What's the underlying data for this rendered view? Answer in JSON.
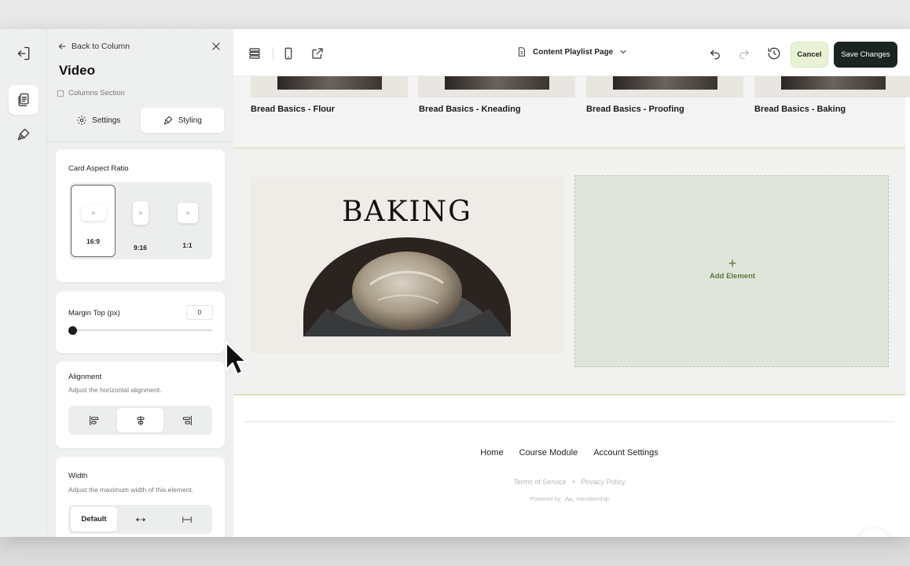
{
  "panel": {
    "back_label": "Back to Column",
    "title": "Video",
    "breadcrumb": "Columns Section",
    "tabs": [
      {
        "label": "Settings",
        "icon": "gear-icon"
      },
      {
        "label": "Styling",
        "icon": "brush-icon",
        "active": true
      }
    ],
    "aspect_ratio": {
      "label": "Card Aspect Ratio",
      "options": [
        {
          "label": "16:9",
          "active": true
        },
        {
          "label": "9:16"
        },
        {
          "label": "1:1"
        }
      ]
    },
    "margin_top": {
      "label": "Margin Top (px)",
      "value": "0"
    },
    "alignment": {
      "label": "Alignment",
      "description": "Adjust the horizontal alignment.",
      "selected": "center"
    },
    "width": {
      "label": "Width",
      "description": "Adjust the maximum width of this element.",
      "options": [
        "Default"
      ]
    }
  },
  "toolbar": {
    "page_name": "Content Playlist Page",
    "cancel_label": "Cancel",
    "save_label": "Save Changes"
  },
  "canvas": {
    "videos": [
      {
        "title": "Bread Basics - Flour"
      },
      {
        "title": "Bread Basics - Kneading"
      },
      {
        "title": "Bread Basics - Proofing"
      },
      {
        "title": "Bread Basics - Baking"
      }
    ],
    "media_title": "BAKING",
    "add_element_label": "Add Element",
    "add_element_symbol": "+"
  },
  "footer": {
    "nav": [
      "Home",
      "Course Module",
      "Account Settings"
    ],
    "terms": "Terms of Service",
    "separator": "•",
    "privacy": "Privacy Policy",
    "powered_by": "Powered by",
    "brand": "membership"
  },
  "colors": {
    "accent_green": "#5a7a3c",
    "save_button_bg": "#1c2422",
    "cancel_button_bg": "#e8f3d6"
  }
}
